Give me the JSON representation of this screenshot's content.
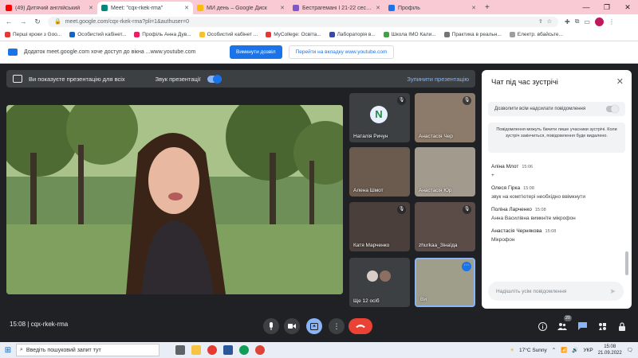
{
  "browser": {
    "tabs": [
      {
        "label": "(49) Дитячий англійський",
        "color": "#ff0000",
        "active": false
      },
      {
        "label": "Meet: \"cqx-rkek-rma\"",
        "color": "#00897b",
        "active": true
      },
      {
        "label": "МИ день – Google Диск",
        "color": "#fbbc04",
        "active": false
      },
      {
        "label": "Бестрагемані I 21-22 сесі - Ф",
        "color": "#7e57c2",
        "active": false
      },
      {
        "label": "Профіль",
        "color": "#1a73e8",
        "active": false
      }
    ],
    "new_tab": "+",
    "url": "meet.google.com/cqx-rkek-rma?pli=1&authuser=0",
    "bookmarks": [
      {
        "label": "Перші кроки з Goo...",
        "color": "#e53935"
      },
      {
        "label": "Особистий кабінет...",
        "color": "#1565c0"
      },
      {
        "label": "Профіль Анна Дув...",
        "color": "#e91e63"
      },
      {
        "label": "Особистий кабінет ...",
        "color": "#fbc02d"
      },
      {
        "label": "MyCollege: Освіта...",
        "color": "#e53935"
      },
      {
        "label": "Лабораторія в...",
        "color": "#3949ab"
      },
      {
        "label": "Школа IMO Кали...",
        "color": "#43a047"
      },
      {
        "label": "Практика в реальн...",
        "color": "#757575"
      },
      {
        "label": "Електр. вбайсьте...",
        "color": "#9e9e9e"
      }
    ]
  },
  "infobar": {
    "text": "Додаток meet.google.com хоче доступ до вікна ...www.youtube.com",
    "allow_label": "Вимкнути дозвіл",
    "open_label": "Перейти на вкладку www.youtube.com"
  },
  "meet": {
    "presenting_text": "Ви показуєте презентацію для всіх",
    "sound_label": "Звук презентації",
    "stop_label": "Зупинити презентацію",
    "participants": [
      {
        "name": "Наталія Ричун",
        "muted": true,
        "avatar_letter": "N"
      },
      {
        "name": "Анастасія Чер",
        "muted": true
      },
      {
        "name": "Алена Шмот",
        "muted": false
      },
      {
        "name": "Анастасія Юр",
        "muted": false
      },
      {
        "name": "Катя Марченко",
        "muted": true
      },
      {
        "name": "zhurkaa_Зінаїда",
        "muted": true
      },
      {
        "name": "Ще 12 осіб",
        "muted": false
      },
      {
        "name": "Ви",
        "muted": false
      }
    ],
    "meeting_time": "15:08",
    "meeting_code": "cqx-rkek-rma",
    "participant_count": "20"
  },
  "chat": {
    "title": "Чат під час зустрічі",
    "permission_label": "Дозволити всім надсилати повідомлення",
    "notice": "Повідомлення можуть бачити лише учасники зустрічі. Коли зустріч закінчиться, повідомлення буде видалено.",
    "messages": [
      {
        "sender": "Аліна Млот",
        "time": "15:06",
        "text": "+"
      },
      {
        "sender": "Олеся Гірка",
        "time": "15:08",
        "text": "звук на комп'ютері необхідно ввімкнути"
      },
      {
        "sender": "Поліна Ларченко",
        "time": "15:08",
        "text": "Анна Василівна вимкніте мікрофон"
      },
      {
        "sender": "Анастасія Чернякова",
        "time": "15:08",
        "text": "Мікрофон"
      }
    ],
    "input_placeholder": "Надішліть усім повідомлення"
  },
  "taskbar": {
    "search_placeholder": "Введіть пошуковий запит тут",
    "weather": "17°C Sunny",
    "lang": "УКР",
    "time": "15:08",
    "date": "21.09.2022"
  }
}
